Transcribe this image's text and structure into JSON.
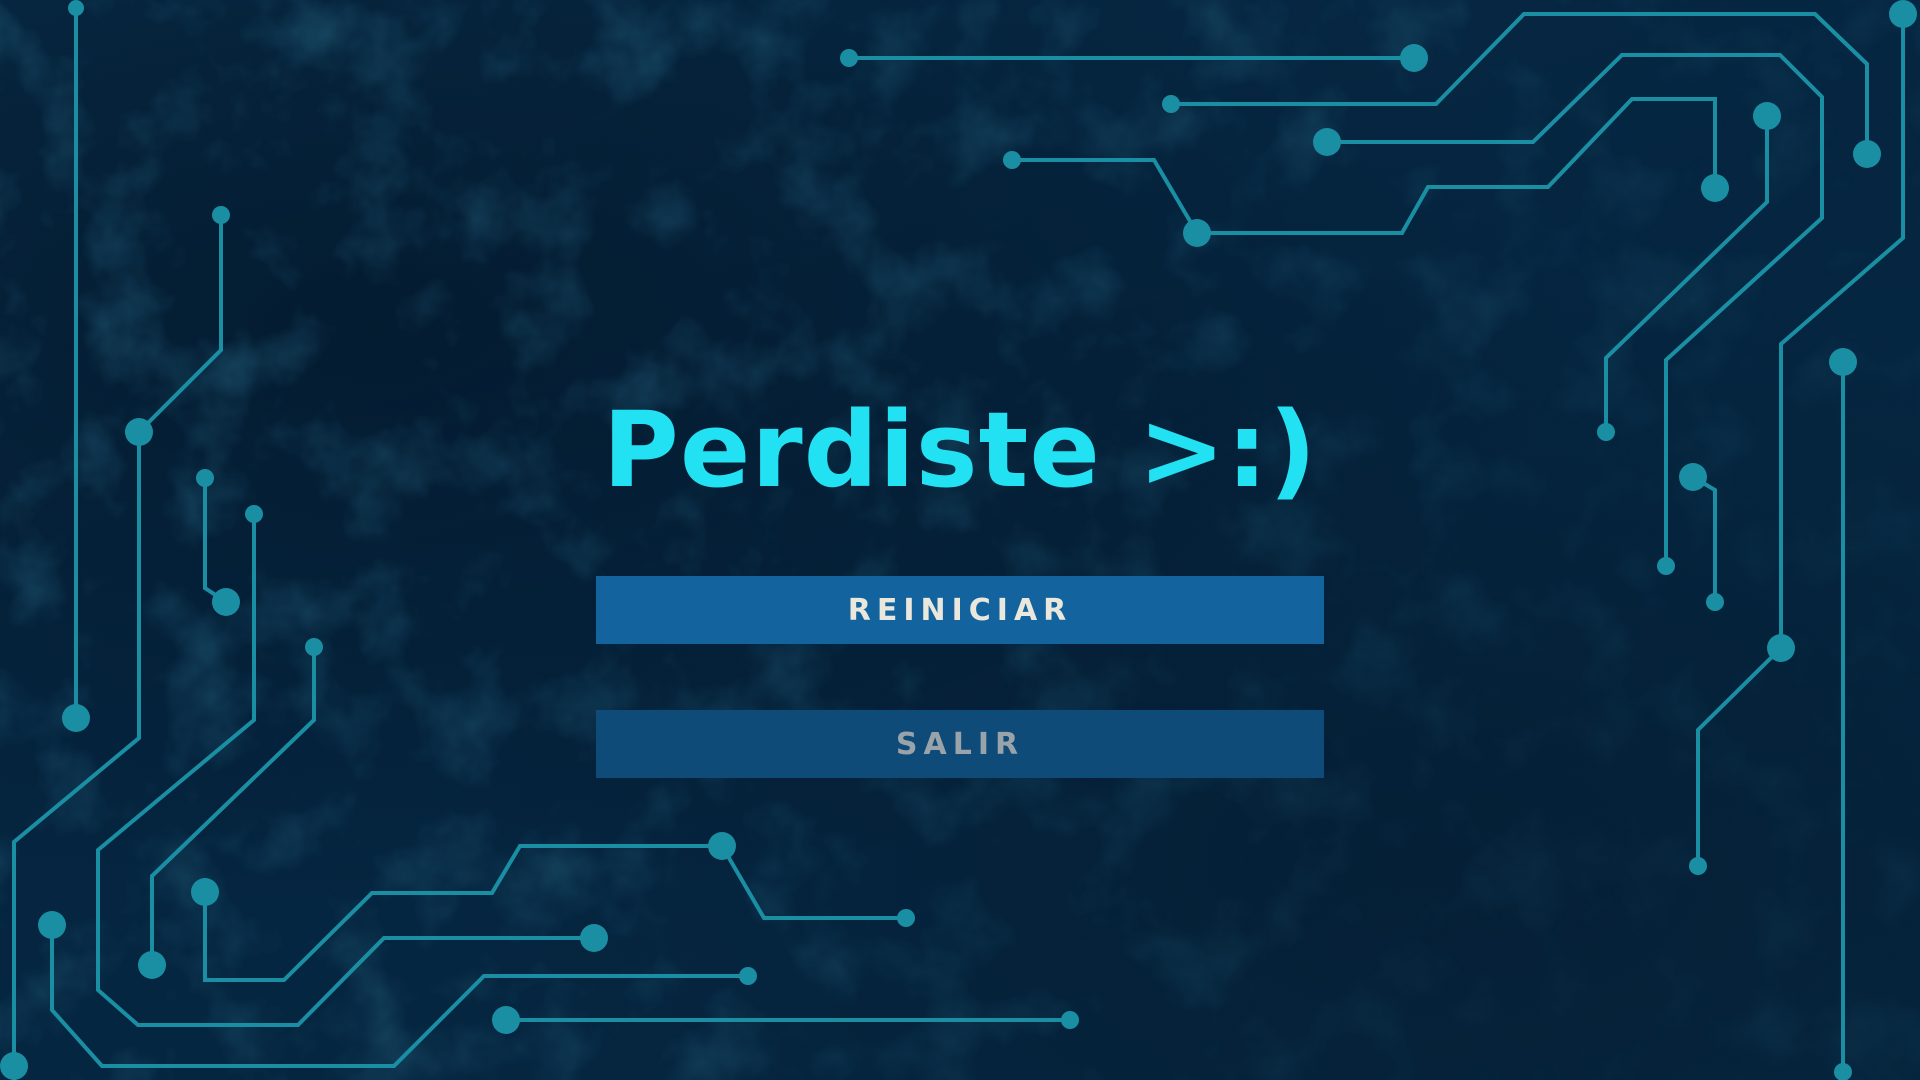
{
  "screen": {
    "title": "Perdiste >:)",
    "buttons": {
      "restart_label": "REINICIAR",
      "exit_label": "SALIR"
    }
  },
  "theme": {
    "background": "#06243d",
    "circuit_color": "#1a8fa3",
    "title_color": "#22e1f2",
    "restart_bg": "#13649e",
    "restart_text": "#eae7dc",
    "exit_bg": "#0e4b78",
    "exit_text": "#9aa3a9"
  },
  "decor": {
    "background_pattern": "circuit-board-traces"
  }
}
